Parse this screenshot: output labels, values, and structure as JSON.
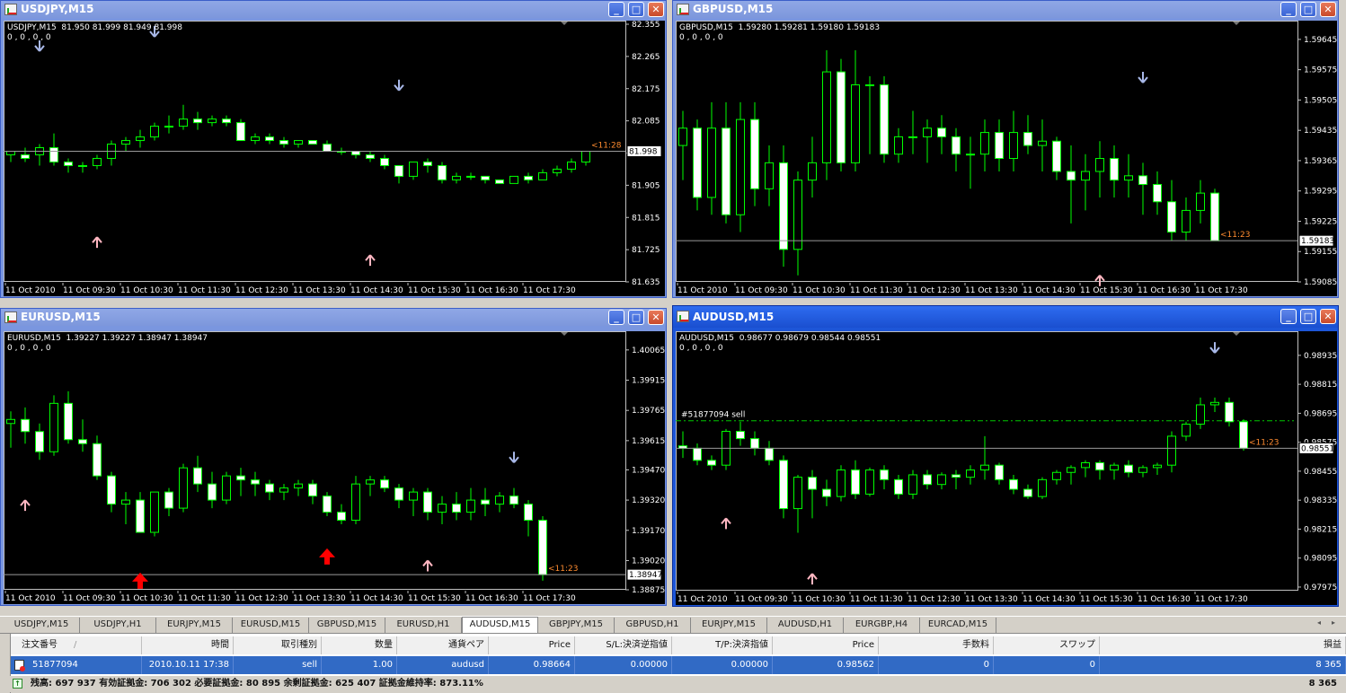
{
  "windows": [
    {
      "id": "usdjpy",
      "title": "USDJPY,M15",
      "header": "USDJPY,M15  81.950 81.999 81.949 81.998",
      "indicator": "0 , 0 , 0 , 0",
      "last_price": "81.998",
      "timer": "<11:28",
      "price_labels": [
        "82.355",
        "82.265",
        "82.175",
        "82.085",
        "81.995",
        "81.905",
        "81.815",
        "81.725",
        "81.635"
      ],
      "time_labels": [
        "11 Oct 2010",
        "11 Oct 09:30",
        "11 Oct 10:30",
        "11 Oct 11:30",
        "11 Oct 12:30",
        "11 Oct 13:30",
        "11 Oct 14:30",
        "11 Oct 15:30",
        "11 Oct 16:30",
        "11 Oct 17:30"
      ],
      "ylim": [
        81.635,
        82.355
      ],
      "candles": [
        [
          81.99,
          82.0,
          81.97,
          82.0
        ],
        [
          81.99,
          82.01,
          81.97,
          81.98
        ],
        [
          81.99,
          82.02,
          81.96,
          82.01
        ],
        [
          82.01,
          82.05,
          81.96,
          81.97
        ],
        [
          81.97,
          81.98,
          81.94,
          81.96
        ],
        [
          81.96,
          81.97,
          81.94,
          81.96
        ],
        [
          81.96,
          81.99,
          81.95,
          81.98
        ],
        [
          81.98,
          82.03,
          81.96,
          82.02
        ],
        [
          82.02,
          82.04,
          82.0,
          82.03
        ],
        [
          82.03,
          82.06,
          82.01,
          82.04
        ],
        [
          82.04,
          82.08,
          82.03,
          82.07
        ],
        [
          82.07,
          82.1,
          82.05,
          82.07
        ],
        [
          82.07,
          82.13,
          82.06,
          82.09
        ],
        [
          82.09,
          82.11,
          82.06,
          82.08
        ],
        [
          82.08,
          82.1,
          82.07,
          82.09
        ],
        [
          82.09,
          82.1,
          82.07,
          82.08
        ],
        [
          82.08,
          82.09,
          82.03,
          82.03
        ],
        [
          82.03,
          82.05,
          82.02,
          82.04
        ],
        [
          82.04,
          82.05,
          82.02,
          82.03
        ],
        [
          82.03,
          82.04,
          82.01,
          82.02
        ],
        [
          82.02,
          82.03,
          82.01,
          82.03
        ],
        [
          82.03,
          82.03,
          82.02,
          82.02
        ],
        [
          82.02,
          82.03,
          82.0,
          82.0
        ],
        [
          82.0,
          82.01,
          81.99,
          82.0
        ],
        [
          82.0,
          82.0,
          81.98,
          81.99
        ],
        [
          81.99,
          82.0,
          81.97,
          81.98
        ],
        [
          81.98,
          81.99,
          81.95,
          81.96
        ],
        [
          81.96,
          81.96,
          81.91,
          81.93
        ],
        [
          81.93,
          81.96,
          81.92,
          81.97
        ],
        [
          81.97,
          81.98,
          81.94,
          81.96
        ],
        [
          81.96,
          81.97,
          81.91,
          81.92
        ],
        [
          81.92,
          81.94,
          81.91,
          81.93
        ],
        [
          81.93,
          81.94,
          81.92,
          81.93
        ],
        [
          81.93,
          81.93,
          81.91,
          81.92
        ],
        [
          81.92,
          81.92,
          81.91,
          81.91
        ],
        [
          81.91,
          81.93,
          81.91,
          81.93
        ],
        [
          81.93,
          81.94,
          81.91,
          81.92
        ],
        [
          81.92,
          81.95,
          81.92,
          81.94
        ],
        [
          81.94,
          81.96,
          81.93,
          81.95
        ],
        [
          81.95,
          81.98,
          81.94,
          81.97
        ],
        [
          81.97,
          81.99,
          81.96,
          82.0
        ]
      ],
      "down_arrows": [
        [
          2,
          82.31
        ],
        [
          10,
          82.35
        ],
        [
          27,
          82.2
        ]
      ],
      "up_arrows": [
        [
          6,
          81.76
        ],
        [
          25,
          81.71
        ]
      ]
    },
    {
      "id": "gbpusd",
      "title": "GBPUSD,M15",
      "header": "GBPUSD,M15  1.59280 1.59281 1.59180 1.59183",
      "indicator": "0 , 0 , 0 , 0",
      "last_price": "1.59183",
      "timer": "<11:23",
      "price_labels": [
        "1.59645",
        "1.59575",
        "1.59505",
        "1.59435",
        "1.59365",
        "1.59295",
        "1.59225",
        "1.59155",
        "1.59085"
      ],
      "time_labels": [
        "11 Oct 2010",
        "11 Oct 09:30",
        "11 Oct 10:30",
        "11 Oct 11:30",
        "11 Oct 12:30",
        "11 Oct 13:30",
        "11 Oct 14:30",
        "11 Oct 15:30",
        "11 Oct 16:30",
        "11 Oct 17:30"
      ],
      "ylim": [
        1.59085,
        1.5968
      ],
      "candles": [
        [
          1.594,
          1.5948,
          1.5932,
          1.5944
        ],
        [
          1.5944,
          1.5946,
          1.5925,
          1.5928
        ],
        [
          1.5928,
          1.595,
          1.5924,
          1.5944
        ],
        [
          1.5944,
          1.595,
          1.5922,
          1.5924
        ],
        [
          1.5924,
          1.595,
          1.592,
          1.5946
        ],
        [
          1.5946,
          1.595,
          1.5926,
          1.593
        ],
        [
          1.593,
          1.594,
          1.5926,
          1.5936
        ],
        [
          1.5936,
          1.594,
          1.5912,
          1.5916
        ],
        [
          1.5916,
          1.5934,
          1.591,
          1.5932
        ],
        [
          1.5932,
          1.5942,
          1.5928,
          1.5936
        ],
        [
          1.5936,
          1.5962,
          1.5932,
          1.5957
        ],
        [
          1.5957,
          1.596,
          1.5934,
          1.5936
        ],
        [
          1.5936,
          1.5962,
          1.5934,
          1.5954
        ],
        [
          1.5954,
          1.5956,
          1.5938,
          1.5954
        ],
        [
          1.5954,
          1.5956,
          1.5936,
          1.5938
        ],
        [
          1.5938,
          1.5944,
          1.5936,
          1.5942
        ],
        [
          1.5942,
          1.5948,
          1.5938,
          1.5942
        ],
        [
          1.5942,
          1.5946,
          1.5936,
          1.5944
        ],
        [
          1.5944,
          1.5947,
          1.5938,
          1.5942
        ],
        [
          1.5942,
          1.5944,
          1.5934,
          1.5938
        ],
        [
          1.5938,
          1.5942,
          1.593,
          1.5938
        ],
        [
          1.5938,
          1.5946,
          1.5934,
          1.5943
        ],
        [
          1.5943,
          1.5946,
          1.5934,
          1.5937
        ],
        [
          1.5937,
          1.5948,
          1.5934,
          1.5943
        ],
        [
          1.5943,
          1.5947,
          1.5938,
          1.594
        ],
        [
          1.594,
          1.5946,
          1.5934,
          1.5941
        ],
        [
          1.5941,
          1.5942,
          1.5932,
          1.5934
        ],
        [
          1.5934,
          1.594,
          1.5922,
          1.5932
        ],
        [
          1.5932,
          1.5938,
          1.5925,
          1.5934
        ],
        [
          1.5934,
          1.5941,
          1.5928,
          1.5937
        ],
        [
          1.5937,
          1.594,
          1.5928,
          1.5932
        ],
        [
          1.5932,
          1.5938,
          1.5928,
          1.5933
        ],
        [
          1.5933,
          1.5936,
          1.5924,
          1.5931
        ],
        [
          1.5931,
          1.5934,
          1.5924,
          1.5927
        ],
        [
          1.5927,
          1.5932,
          1.5918,
          1.592
        ],
        [
          1.592,
          1.5928,
          1.5918,
          1.5925
        ],
        [
          1.5925,
          1.5932,
          1.5922,
          1.5929
        ],
        [
          1.5929,
          1.593,
          1.5918,
          1.5918
        ]
      ],
      "down_arrows": [
        [
          32,
          1.5957
        ]
      ],
      "up_arrows": [
        [
          29,
          1.591
        ]
      ]
    },
    {
      "id": "eurusd",
      "title": "EURUSD,M15",
      "header": "EURUSD,M15  1.39227 1.39227 1.38947 1.38947",
      "indicator": "0 , 0 , 0 , 0",
      "last_price": "1.38947",
      "timer": "<11:23",
      "price_labels": [
        "1.40065",
        "1.39915",
        "1.39765",
        "1.39615",
        "1.39470",
        "1.39320",
        "1.39170",
        "1.39020",
        "1.38875"
      ],
      "time_labels": [
        "11 Oct 2010",
        "11 Oct 09:30",
        "11 Oct 10:30",
        "11 Oct 11:30",
        "11 Oct 12:30",
        "11 Oct 13:30",
        "11 Oct 14:30",
        "11 Oct 15:30",
        "11 Oct 16:30",
        "11 Oct 17:30"
      ],
      "ylim": [
        1.38875,
        1.4014
      ],
      "candles": [
        [
          1.397,
          1.3976,
          1.3958,
          1.3972
        ],
        [
          1.3972,
          1.3978,
          1.396,
          1.3966
        ],
        [
          1.3966,
          1.397,
          1.3952,
          1.3956
        ],
        [
          1.3956,
          1.3984,
          1.3954,
          1.398
        ],
        [
          1.398,
          1.3986,
          1.396,
          1.3962
        ],
        [
          1.3962,
          1.3972,
          1.3956,
          1.396
        ],
        [
          1.396,
          1.3964,
          1.3942,
          1.3944
        ],
        [
          1.3944,
          1.3946,
          1.3926,
          1.393
        ],
        [
          1.393,
          1.3936,
          1.392,
          1.3932
        ],
        [
          1.3932,
          1.3936,
          1.3916,
          1.3916
        ],
        [
          1.3916,
          1.3936,
          1.3914,
          1.3936
        ],
        [
          1.3936,
          1.3938,
          1.3924,
          1.3928
        ],
        [
          1.3928,
          1.395,
          1.3926,
          1.3948
        ],
        [
          1.3948,
          1.3954,
          1.3936,
          1.394
        ],
        [
          1.394,
          1.3946,
          1.3928,
          1.3932
        ],
        [
          1.3932,
          1.3946,
          1.393,
          1.3944
        ],
        [
          1.3944,
          1.3948,
          1.3934,
          1.3942
        ],
        [
          1.3942,
          1.3946,
          1.3934,
          1.394
        ],
        [
          1.394,
          1.3942,
          1.3932,
          1.3936
        ],
        [
          1.3936,
          1.394,
          1.3932,
          1.3938
        ],
        [
          1.3938,
          1.3942,
          1.3934,
          1.394
        ],
        [
          1.394,
          1.3942,
          1.393,
          1.3934
        ],
        [
          1.3934,
          1.3936,
          1.3924,
          1.3926
        ],
        [
          1.3926,
          1.393,
          1.392,
          1.3922
        ],
        [
          1.3922,
          1.3944,
          1.392,
          1.394
        ],
        [
          1.394,
          1.3944,
          1.3934,
          1.3942
        ],
        [
          1.3942,
          1.3944,
          1.3936,
          1.3938
        ],
        [
          1.3938,
          1.394,
          1.3928,
          1.3932
        ],
        [
          1.3932,
          1.3938,
          1.3924,
          1.3936
        ],
        [
          1.3936,
          1.3938,
          1.3922,
          1.3926
        ],
        [
          1.3926,
          1.3934,
          1.392,
          1.393
        ],
        [
          1.393,
          1.3936,
          1.3922,
          1.3926
        ],
        [
          1.3926,
          1.3938,
          1.3922,
          1.3932
        ],
        [
          1.3932,
          1.3938,
          1.3924,
          1.393
        ],
        [
          1.393,
          1.3936,
          1.3926,
          1.3934
        ],
        [
          1.3934,
          1.3938,
          1.3928,
          1.393
        ],
        [
          1.393,
          1.3932,
          1.3914,
          1.3922
        ],
        [
          1.3922,
          1.3924,
          1.3892,
          1.3895
        ]
      ],
      "down_arrows": [
        [
          35,
          1.3956
        ]
      ],
      "up_arrows": [
        [
          1,
          1.3932
        ],
        [
          29,
          1.3902
        ]
      ],
      "big_up_arrows": [
        [
          9,
          1.3888
        ],
        [
          22,
          1.39
        ]
      ]
    },
    {
      "id": "audusd",
      "title": "AUDUSD,M15",
      "header": "AUDUSD,M15  0.98677 0.98679 0.98544 0.98551",
      "indicator": "0 , 0 , 0 , 0",
      "last_price": "0.98551",
      "timer": "<11:23",
      "order_label": "#51877094 sell",
      "order_price": 0.98664,
      "price_labels": [
        "0.98935",
        "0.98815",
        "0.98695",
        "0.98575",
        "0.98455",
        "0.98335",
        "0.98215",
        "0.98095",
        "0.97975"
      ],
      "time_labels": [
        "11 Oct 2010",
        "11 Oct 09:30",
        "11 Oct 10:30",
        "11 Oct 11:30",
        "11 Oct 12:30",
        "11 Oct 13:30",
        "11 Oct 14:30",
        "11 Oct 15:30",
        "11 Oct 16:30",
        "11 Oct 17:30"
      ],
      "ylim": [
        0.9796,
        0.9902
      ],
      "candles": [
        [
          0.9856,
          0.9862,
          0.9851,
          0.9855
        ],
        [
          0.9855,
          0.9857,
          0.9848,
          0.985
        ],
        [
          0.985,
          0.9852,
          0.9846,
          0.9848
        ],
        [
          0.9848,
          0.9863,
          0.9846,
          0.9862
        ],
        [
          0.9862,
          0.9866,
          0.9856,
          0.9859
        ],
        [
          0.9859,
          0.9862,
          0.9852,
          0.9855
        ],
        [
          0.9855,
          0.9858,
          0.9848,
          0.985
        ],
        [
          0.985,
          0.9852,
          0.9826,
          0.983
        ],
        [
          0.983,
          0.9844,
          0.982,
          0.9843
        ],
        [
          0.9843,
          0.9846,
          0.9826,
          0.9838
        ],
        [
          0.9838,
          0.9842,
          0.9831,
          0.9835
        ],
        [
          0.9835,
          0.9848,
          0.9833,
          0.9846
        ],
        [
          0.9846,
          0.985,
          0.9834,
          0.9836
        ],
        [
          0.9836,
          0.9847,
          0.9835,
          0.9846
        ],
        [
          0.9846,
          0.9848,
          0.9838,
          0.9842
        ],
        [
          0.9842,
          0.9844,
          0.9834,
          0.9836
        ],
        [
          0.9836,
          0.9846,
          0.9834,
          0.9844
        ],
        [
          0.9844,
          0.9846,
          0.9838,
          0.984
        ],
        [
          0.984,
          0.9845,
          0.9838,
          0.9844
        ],
        [
          0.9844,
          0.9846,
          0.9838,
          0.9843
        ],
        [
          0.9843,
          0.9848,
          0.984,
          0.9846
        ],
        [
          0.9846,
          0.986,
          0.9842,
          0.9848
        ],
        [
          0.9848,
          0.9849,
          0.984,
          0.9842
        ],
        [
          0.9842,
          0.9844,
          0.9836,
          0.9838
        ],
        [
          0.9838,
          0.984,
          0.9834,
          0.9835
        ],
        [
          0.9835,
          0.9843,
          0.9834,
          0.9842
        ],
        [
          0.9842,
          0.9846,
          0.984,
          0.9845
        ],
        [
          0.9845,
          0.9848,
          0.984,
          0.9847
        ],
        [
          0.9847,
          0.985,
          0.9843,
          0.9849
        ],
        [
          0.9849,
          0.985,
          0.9842,
          0.9846
        ],
        [
          0.9846,
          0.9849,
          0.9842,
          0.9848
        ],
        [
          0.9848,
          0.985,
          0.9843,
          0.9845
        ],
        [
          0.9845,
          0.9848,
          0.9843,
          0.9847
        ],
        [
          0.9847,
          0.9849,
          0.9844,
          0.9848
        ],
        [
          0.9848,
          0.9862,
          0.9845,
          0.986
        ],
        [
          0.986,
          0.9866,
          0.9858,
          0.9865
        ],
        [
          0.9865,
          0.9876,
          0.9863,
          0.9873
        ],
        [
          0.9873,
          0.9876,
          0.987,
          0.9874
        ],
        [
          0.9874,
          0.9876,
          0.9864,
          0.9866
        ],
        [
          0.9866,
          0.9867,
          0.9854,
          0.9855
        ]
      ],
      "down_arrows": [
        [
          37,
          0.9899
        ]
      ],
      "up_arrows": [
        [
          3,
          0.9826
        ],
        [
          9,
          0.9803
        ]
      ]
    }
  ],
  "tabs": [
    "USDJPY,M15",
    "USDJPY,H1",
    "EURJPY,M15",
    "EURUSD,M15",
    "GBPUSD,M15",
    "EURUSD,H1",
    "AUDUSD,M15",
    "GBPJPY,M15",
    "GBPUSD,H1",
    "EURJPY,M15",
    "AUDUSD,H1",
    "EURGBP,H4",
    "EURCAD,M15"
  ],
  "selected_tab": 6,
  "terminal": {
    "headers": [
      "注文番号",
      "時間",
      "取引種別",
      "数量",
      "通貨ペア",
      "Price",
      "S/L:決済逆指値",
      "T/P:決済指値",
      "Price",
      "手数料",
      "スワップ",
      "損益"
    ],
    "sort_glyph": "/",
    "row": [
      "51877094",
      "2010.10.11 17:38",
      "sell",
      "1.00",
      "audusd",
      "0.98664",
      "0.00000",
      "0.00000",
      "0.98562",
      "0",
      "0",
      "8 365"
    ],
    "balance_text": "残高: 697 937  有効証拠金: 706 302  必要証拠金: 80 895  余剰証拠金: 625 407  証拠金維持率: 873.11%",
    "balance_total": "8 365"
  },
  "colors": {
    "bull_fill": "#000000",
    "bull_stroke": "#00ff00",
    "bear_fill": "#ffffff",
    "grid_axis": "#c0c0c0",
    "down_arrow": "#a8b8e8",
    "up_arrow": "#ffb6c1",
    "big_up_arrow": "#ff0000",
    "timer": "#ff8c30",
    "order_line": "#00c800"
  }
}
